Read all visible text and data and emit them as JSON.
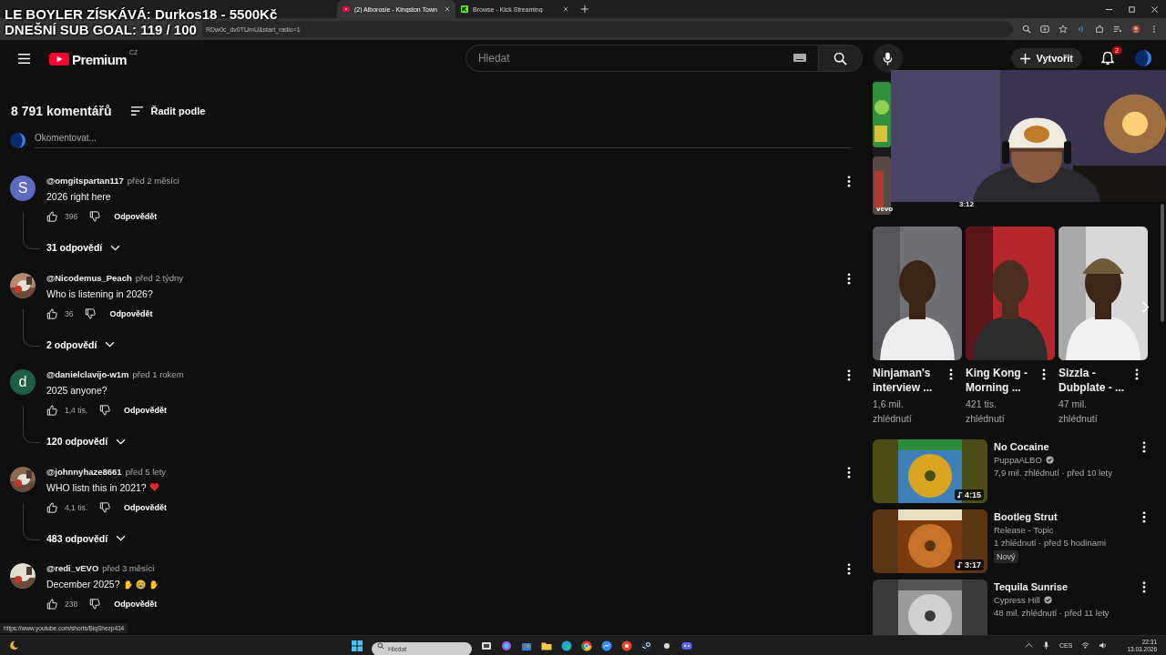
{
  "overlay": {
    "lines": [
      "LE BOYLER ZÍSKÁVÁ: Durkos18 - 5500Kč",
      "DNEŠNÍ SUB GOAL: 119 / 100"
    ]
  },
  "browser": {
    "tabs": [
      {
        "kind": "youtube",
        "title": "(2) Alborosie - Kingston Town",
        "selected": true
      },
      {
        "kind": "kick",
        "title": "Browse - Kick Streaming",
        "selected": false
      }
    ],
    "url": "RDw0c_dv0TUmU&start_radio=1"
  },
  "header": {
    "logo": "Premium",
    "region": "CZ",
    "search_placeholder": "Hledat",
    "create": "Vytvořit",
    "notifications": "2"
  },
  "comments_header": {
    "count": "8 791 komentářů",
    "sort": "Řadit podle",
    "input_placeholder": "Okomentovat..."
  },
  "comments": [
    {
      "avatar": {
        "kind": "letter",
        "letter": "S",
        "color": "#5c6bc0"
      },
      "author": "@omgitspartan117",
      "time": "před 2 měsíci",
      "text": "2026 right here",
      "likes": "396",
      "reply": "Odpovědět",
      "replies": "31 odpovědí"
    },
    {
      "avatar": {
        "kind": "picture"
      },
      "author": "@Nicodemus_Peach",
      "time": "před 2 týdny",
      "text": "Who is listening in 2026?",
      "likes": "36",
      "reply": "Odpovědět",
      "replies": "2 odpovědí"
    },
    {
      "avatar": {
        "kind": "letter",
        "letter": "d",
        "color": "#1e5e45"
      },
      "author": "@danielclavijo-w1m",
      "time": "před 1 rokem",
      "text": "2025 anyone?",
      "likes": "1,4 tis.",
      "reply": "Odpovědět",
      "replies": "120 odpovědí"
    },
    {
      "avatar": {
        "kind": "picture"
      },
      "author": "@johnnyhaze8661",
      "time": "před 5 lety",
      "text": "WHO listn this in 2021?",
      "icons": [
        {
          "kind": "heart"
        }
      ],
      "likes": "4,1 tis.",
      "reply": "Odpovědět",
      "replies": "483 odpovědí"
    },
    {
      "avatar": {
        "kind": "picture"
      },
      "author": "@redi_vEVO",
      "time": "před 3 měsíci",
      "text": "December 2025?",
      "icons": [
        {
          "kind": "hand"
        },
        {
          "kind": "crying"
        },
        {
          "kind": "hand"
        }
      ],
      "likes": "238",
      "reply": "Odpovědět"
    }
  ],
  "top_strip": {
    "label": "vevo",
    "duration": "3:12"
  },
  "shorts": [
    {
      "title": "Ninjaman's interview ...",
      "views": "1,6 mil. zhlédnutí"
    },
    {
      "title": "King Kong - Morning ...",
      "views": "421 tis. zhlédnutí"
    },
    {
      "title": "Sizzla - Dubplate - ...",
      "views": "47 mil. zhlédnutí"
    }
  ],
  "videos": [
    {
      "title": "No Cocaine",
      "channel": "PuppaALBO",
      "verified": true,
      "meta": "7,9 mil. zhlédnutí · před 10 lety",
      "duration": "4:15"
    },
    {
      "title": "Bootleg Strut",
      "channel": "Release - Topic",
      "verified": false,
      "meta": "1 zhlédnutí · před 5 hodinami",
      "badge": "Nový",
      "duration": "3:17"
    },
    {
      "title": "Tequila Sunrise",
      "channel": "Cypress Hill",
      "verified": true,
      "meta": "48 mil. zhlédnutí · před 11 lety"
    }
  ],
  "status_url": "https://www.youtube.com/shorts/BiqShezp434",
  "taskbar": {
    "search_placeholder": "Hledat",
    "language": "CES",
    "time": "22:31",
    "date": "13.03.2026"
  }
}
